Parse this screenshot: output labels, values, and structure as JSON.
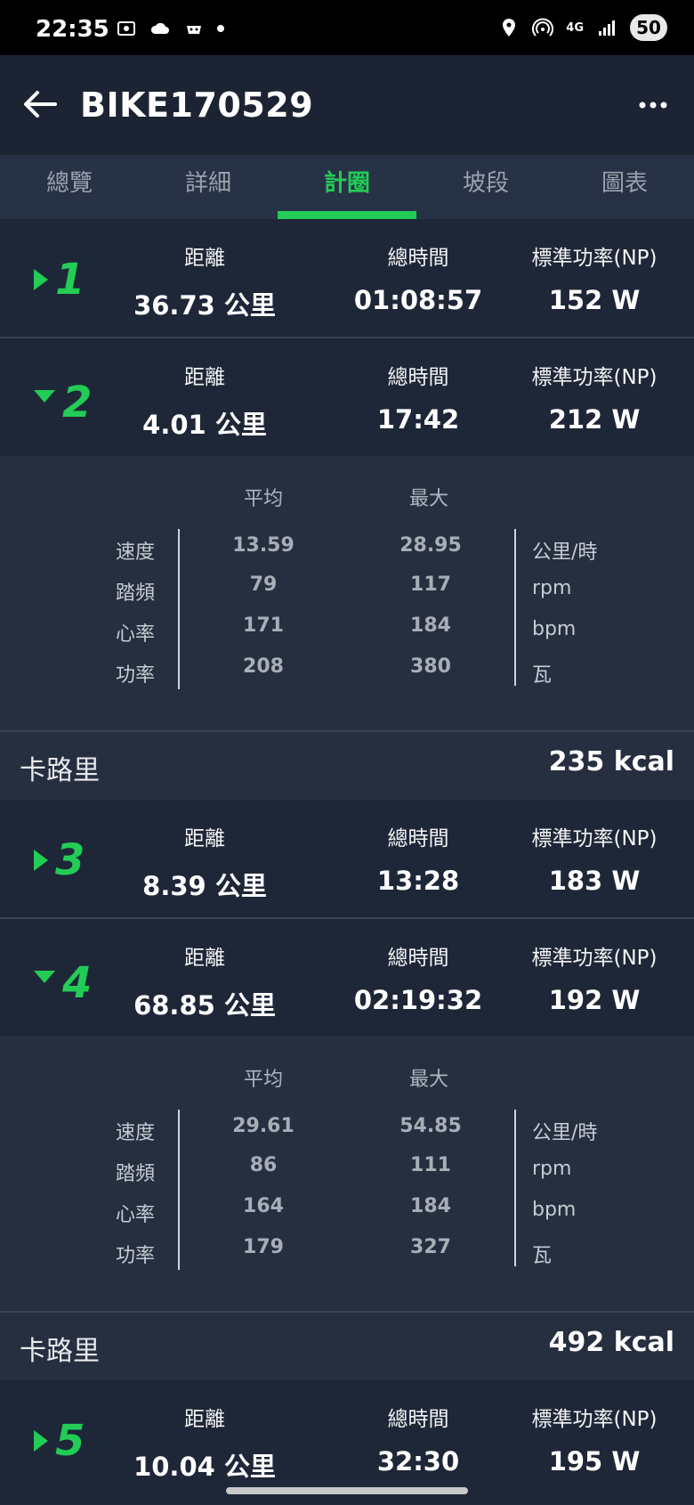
{
  "status": {
    "time": "22:35",
    "network": "4G",
    "battery": "50"
  },
  "header": {
    "title": "BIKE170529"
  },
  "tabs": [
    {
      "label": "總覽"
    },
    {
      "label": "詳細"
    },
    {
      "label": "計圈",
      "active": true
    },
    {
      "label": "坡段"
    },
    {
      "label": "圖表"
    }
  ],
  "columns": {
    "distance": "距離",
    "total_time": "總時間",
    "np": "標準功率(NP)"
  },
  "detail_headers": {
    "avg": "平均",
    "max": "最大"
  },
  "metric_labels": [
    "速度",
    "踏頻",
    "心率",
    "功率"
  ],
  "metric_units": [
    "公里/時",
    "rpm",
    "bpm",
    "瓦"
  ],
  "calories_label": "卡路里",
  "laps": [
    {
      "num": "1",
      "expanded": false,
      "distance": "36.73 公里",
      "time": "01:08:57",
      "np": "152 W"
    },
    {
      "num": "2",
      "expanded": true,
      "distance": "4.01 公里",
      "time": "17:42",
      "np": "212 W",
      "detail": {
        "avg": [
          "13.59",
          "79",
          "171",
          "208"
        ],
        "max": [
          "28.95",
          "117",
          "184",
          "380"
        ]
      },
      "calories": "235 kcal"
    },
    {
      "num": "3",
      "expanded": false,
      "distance": "8.39 公里",
      "time": "13:28",
      "np": "183 W"
    },
    {
      "num": "4",
      "expanded": true,
      "distance": "68.85 公里",
      "time": "02:19:32",
      "np": "192 W",
      "detail": {
        "avg": [
          "29.61",
          "86",
          "164",
          "179"
        ],
        "max": [
          "54.85",
          "111",
          "184",
          "327"
        ]
      },
      "calories": "492 kcal"
    },
    {
      "num": "5",
      "expanded": false,
      "distance": "10.04 公里",
      "time": "32:30",
      "np": "195 W"
    }
  ],
  "colors": {
    "accent": "#22cc55",
    "background": "#1f2738"
  }
}
